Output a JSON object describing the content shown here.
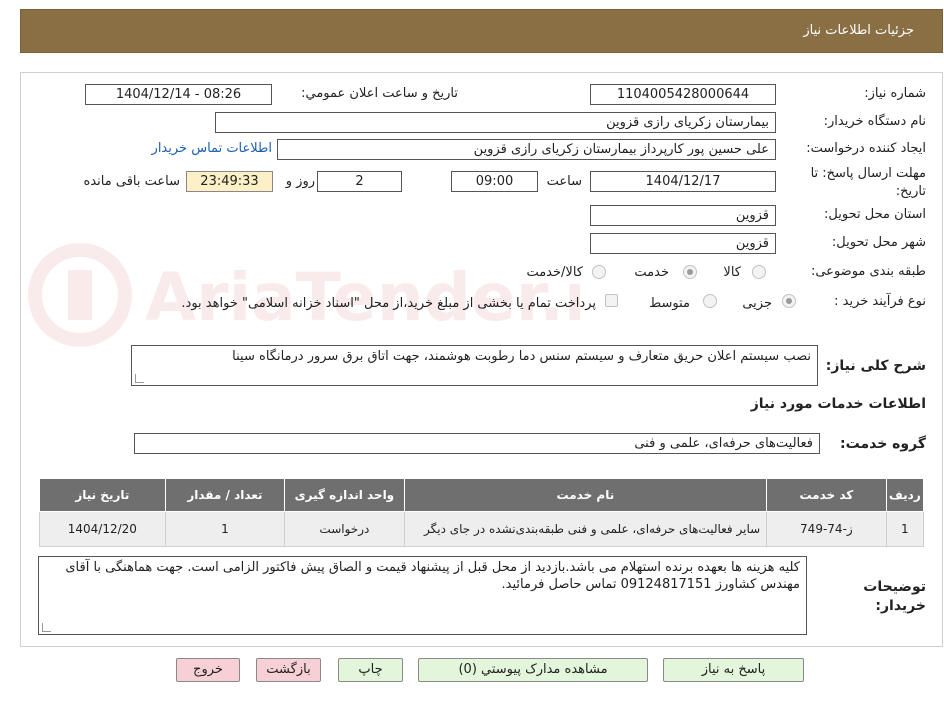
{
  "header": {
    "title": "جزئیات اطلاعات نیاز"
  },
  "watermark": {
    "text": "AriaTender.neT"
  },
  "fields": {
    "need_number_label": "شماره نیاز:",
    "need_number": "1104005428000644",
    "announce_label": "تاریخ و ساعت اعلان عمومي:",
    "announce_value": "1404/12/14 - 08:26",
    "buyer_org_label": "نام دستگاه خریدار:",
    "buyer_org": "بيمارستان زکریای رازی قزوین",
    "creator_label": "ایجاد کننده درخواست:",
    "creator": "علی حسین پور کارپرداز بیمارستان زکریای رازی قزوین",
    "contact_link": "اطلاعات تماس خریدار",
    "deadline_label": "مهلت ارسال پاسخ: تا تاریخ:",
    "deadline_date": "1404/12/17",
    "time_label": "ساعت",
    "deadline_time": "09:00",
    "days_value": "2",
    "days_label": "روز و",
    "remaining_time": "23:49:33",
    "remaining_label": "ساعت باقی مانده",
    "province_label": "استان محل تحویل:",
    "province": "قزوین",
    "city_label": "شهر محل تحویل:",
    "city": "قزوین",
    "category_label": "طبقه بندی موضوعی:",
    "category_options": [
      "کالا",
      "خدمت",
      "کالا/خدمت"
    ],
    "category_selected": "خدمت",
    "process_label": "نوع فرآیند خرید :",
    "process_options": [
      "جزیی",
      "متوسط"
    ],
    "process_selected": "جزیی",
    "payment_note": "پرداخت تمام یا بخشی از مبلغ خرید،از محل \"اسناد خزانه اسلامی\" خواهد بود."
  },
  "description": {
    "label": "شرح کلی نیاز:",
    "text": "نصب سیستم اعلان حریق متعارف و سیستم سنس دما رطوبت هوشمند، جهت اتاق برق سرور درمانگاه سینا"
  },
  "services": {
    "section_title": "اطلاعات خدمات مورد نیاز",
    "group_label": "گروه خدمت:",
    "group_value": "فعالیت‌های حرفه‌ای، علمی و فنی",
    "columns": [
      "ردیف",
      "کد خدمت",
      "نام خدمت",
      "واحد اندازه گیری",
      "تعداد / مقدار",
      "تاریخ نیاز"
    ],
    "rows": [
      {
        "row": "1",
        "code": "ز-74-749",
        "name": "سایر فعالیت‌های حرفه‌ای، علمی و فنی طبقه‌بندی‌نشده در جای دیگر",
        "unit": "درخواست",
        "qty": "1",
        "date": "1404/12/20"
      }
    ]
  },
  "buyer_notes": {
    "label": "توضیحات خریدار:",
    "text": "کلیه هزینه ها بعهده برنده استهلام می باشد.بازدید از محل قبل از پیشنهاد قیمت و الصاق پیش فاکتور الزامی است. جهت هماهنگی با آقای مهندس کشاورز 09124817151 تماس حاصل فرمائید."
  },
  "buttons": {
    "reply": "پاسخ به نیاز",
    "attachments": "مشاهده مدارک پیوستي (0)",
    "print": "چاپ",
    "back": "بازگشت",
    "exit": "خروج"
  },
  "colors": {
    "header_bg": "#8b6f44",
    "table_header_bg": "#6f6f6f",
    "timer_bg": "#fdf0c6",
    "link": "#1a5fb4",
    "green_button": "#e3f6dc",
    "red_button": "#f7d0d6"
  }
}
